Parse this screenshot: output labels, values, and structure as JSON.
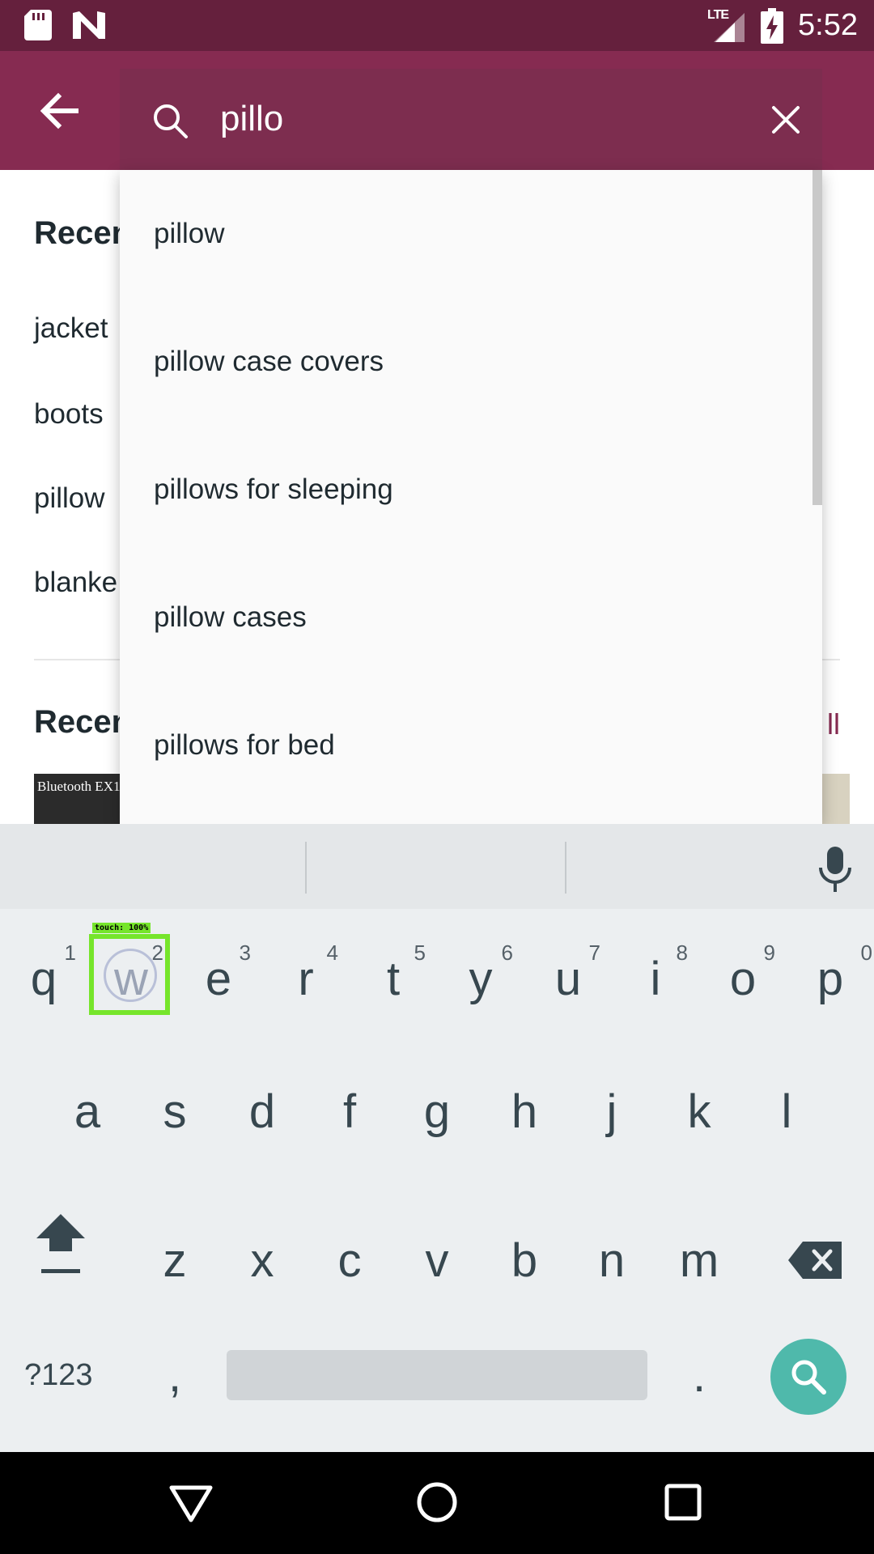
{
  "status_bar": {
    "network": "LTE",
    "time": "5:52"
  },
  "search": {
    "query": "pillo"
  },
  "background": {
    "recent_searches_heading": "Recen",
    "recent_searches": [
      "jacket",
      "boots",
      "pillow",
      "blanke"
    ],
    "recently_viewed_heading": "Recen",
    "view_all": "ll",
    "thumb_text": "Bluetooth EX1"
  },
  "suggestions": [
    "pillow",
    "pillow case covers",
    "pillows for sleeping",
    "pillow cases",
    "pillows for bed"
  ],
  "keyboard": {
    "row1": [
      {
        "k": "q",
        "h": "1"
      },
      {
        "k": "w",
        "h": "2"
      },
      {
        "k": "e",
        "h": "3"
      },
      {
        "k": "r",
        "h": "4"
      },
      {
        "k": "t",
        "h": "5"
      },
      {
        "k": "y",
        "h": "6"
      },
      {
        "k": "u",
        "h": "7"
      },
      {
        "k": "i",
        "h": "8"
      },
      {
        "k": "o",
        "h": "9"
      },
      {
        "k": "p",
        "h": "0"
      }
    ],
    "row2": [
      "a",
      "s",
      "d",
      "f",
      "g",
      "h",
      "j",
      "k",
      "l"
    ],
    "row3": [
      "z",
      "x",
      "c",
      "v",
      "b",
      "n",
      "m"
    ],
    "symbols": "?123",
    "comma": ",",
    "period": ".",
    "touch_label": "touch: 100%"
  },
  "colors": {
    "status_bar": "#65203d",
    "app_bar": "#862b51",
    "search_key": "#4fb9ab",
    "touch_highlight": "#76e52b"
  }
}
